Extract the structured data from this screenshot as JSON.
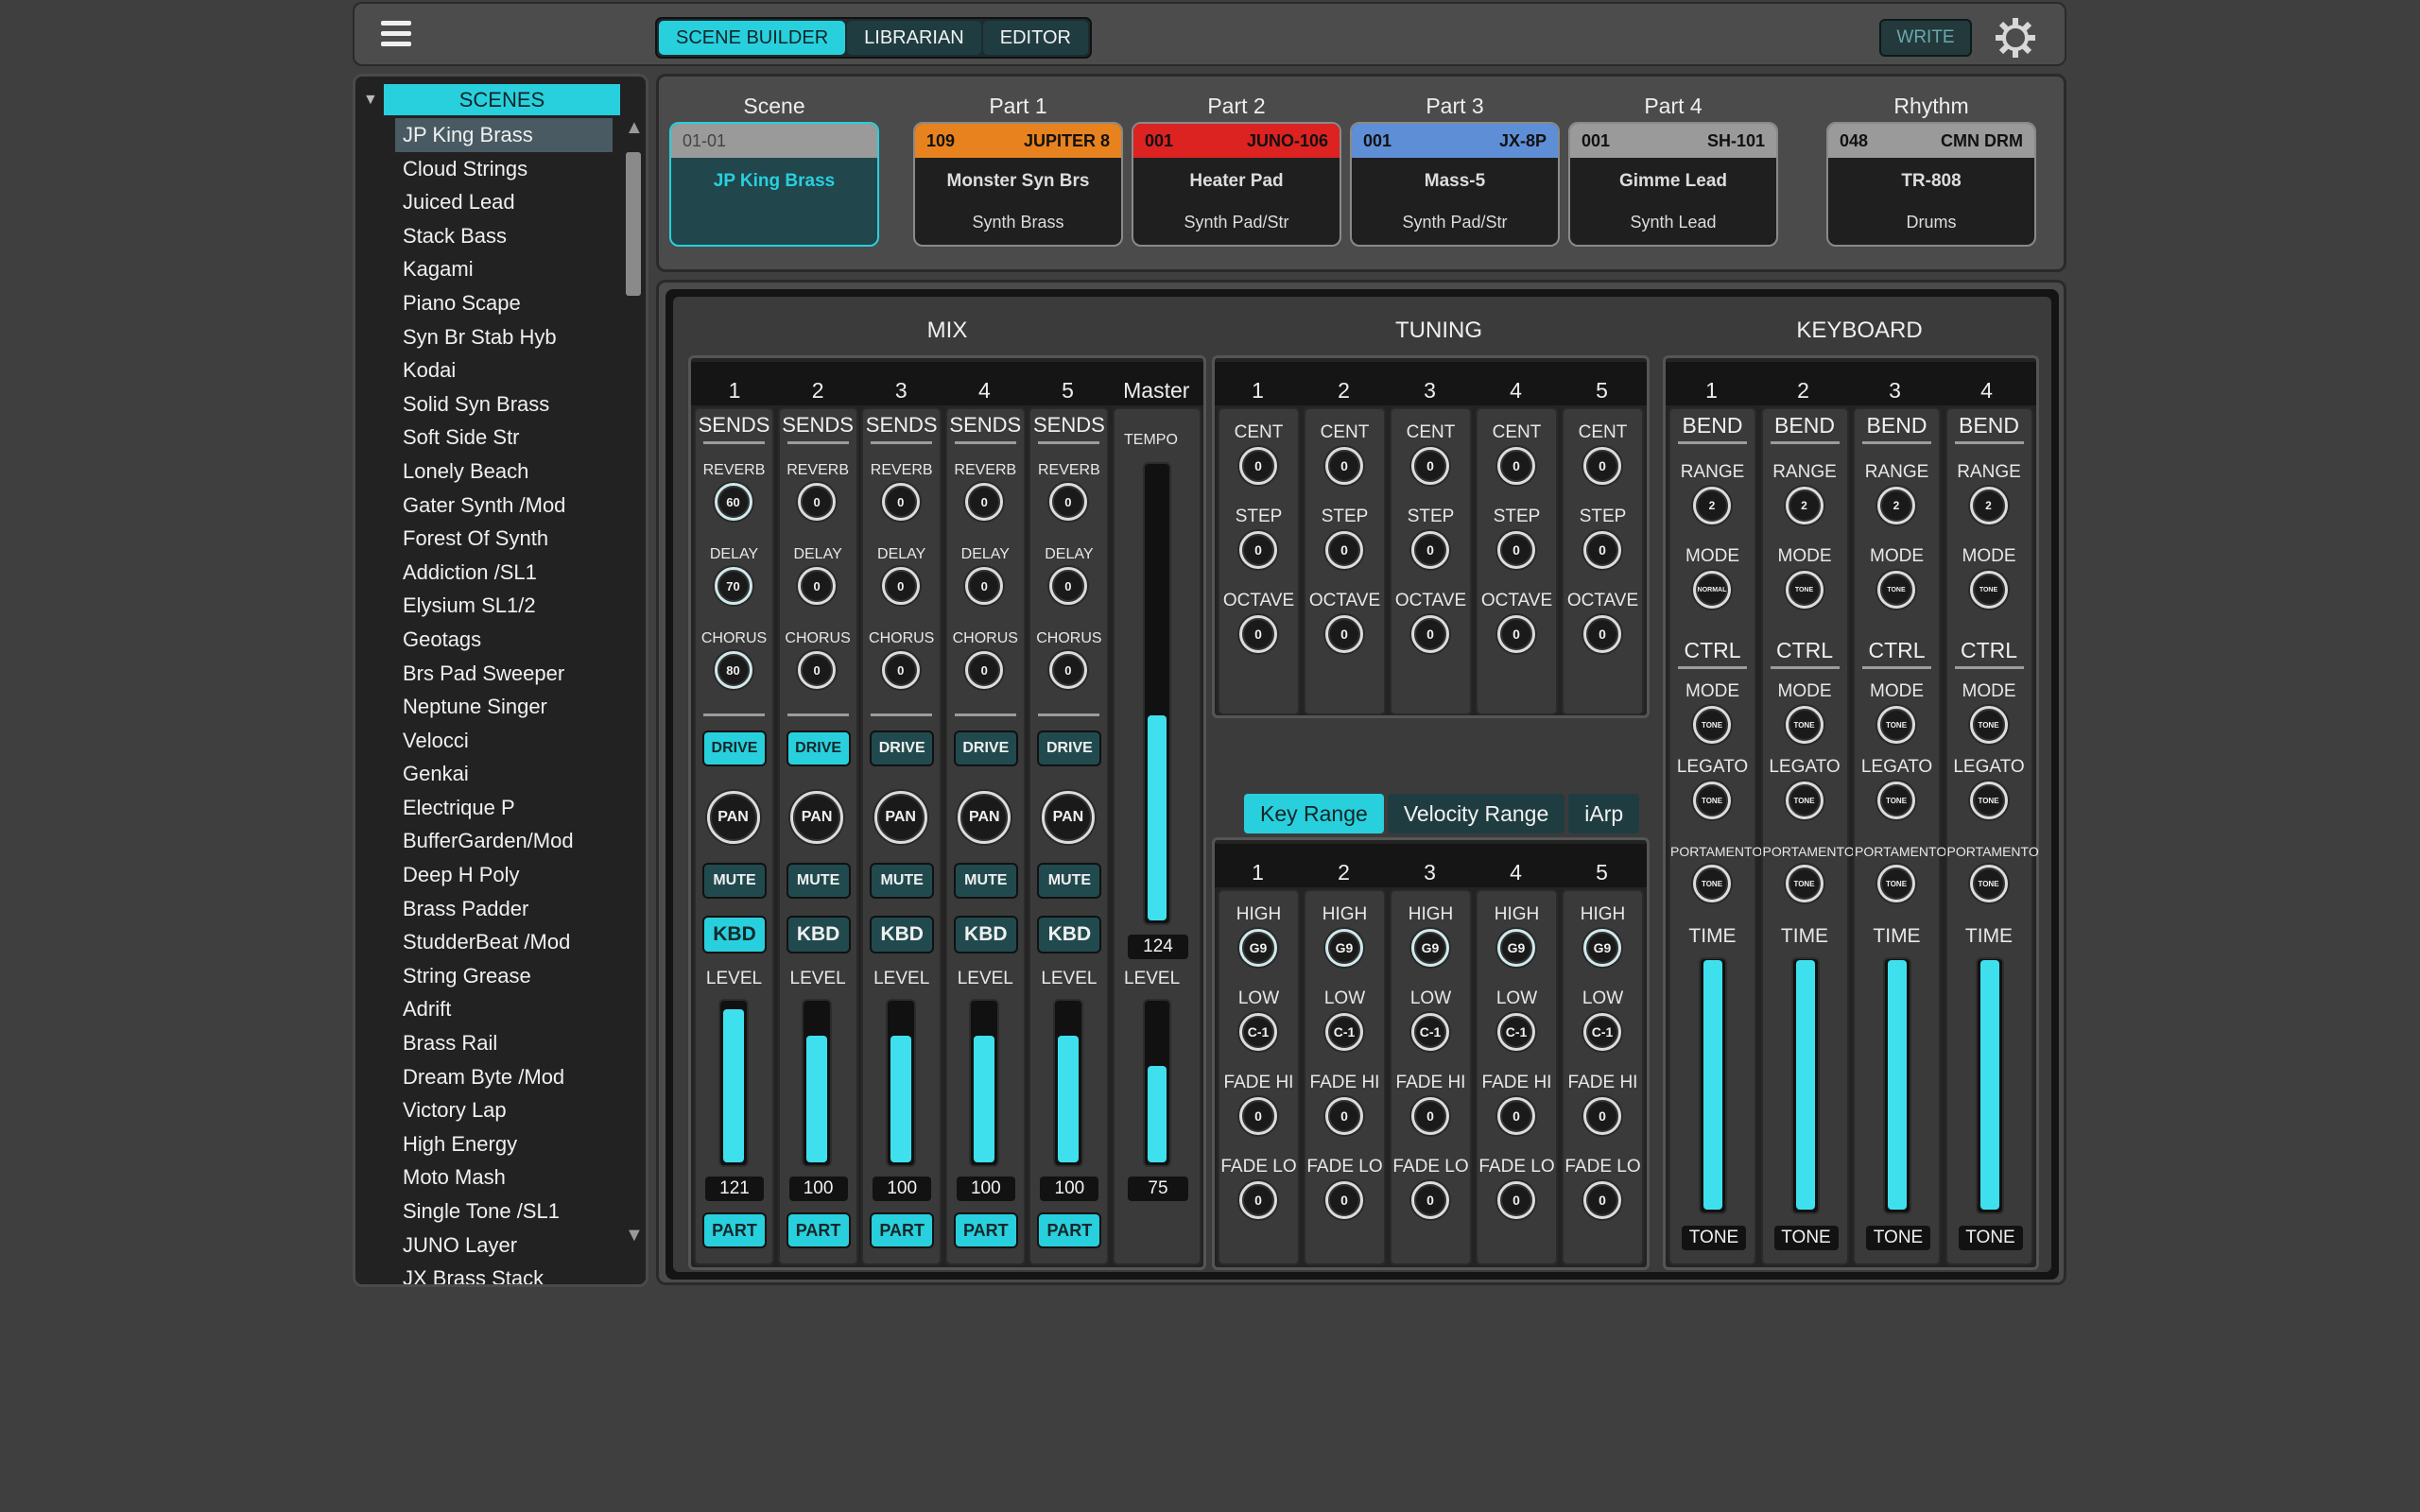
{
  "topbar": {
    "tabs": [
      {
        "label": "SCENE BUILDER",
        "active": true
      },
      {
        "label": "LIBRARIAN",
        "active": false
      },
      {
        "label": "EDITOR",
        "active": false
      }
    ],
    "write_label": "WRITE",
    "icons": {
      "menu": "hamburger-menu-icon",
      "settings": "gear-icon"
    }
  },
  "colors": {
    "accent": "#28d0dd",
    "jupiter": "#e8821e",
    "juno": "#dd2222",
    "jx": "#5e8fd6",
    "sh": "#9a9a9a",
    "drum": "#9a9a9a"
  },
  "scenes": {
    "title": "SCENES",
    "selected_index": 0,
    "items": [
      "JP King Brass",
      "Cloud Strings",
      "Juiced Lead",
      "Stack Bass",
      "Kagami",
      "Piano Scape",
      "Syn Br Stab Hyb",
      "Kodai",
      "Solid Syn Brass",
      "Soft Side Str",
      "Lonely Beach",
      "Gater Synth /Mod",
      "Forest Of Synth",
      "Addiction /SL1",
      "Elysium SL1/2",
      "Geotags",
      "Brs Pad Sweeper",
      "Neptune Singer",
      "Velocci",
      "Genkai",
      "Electrique P",
      "BufferGarden/Mod",
      "Deep H Poly",
      "Brass Padder",
      "StudderBeat /Mod",
      "String Grease",
      "Adrift",
      "Brass Rail",
      "Dream Byte /Mod",
      "Victory Lap",
      "High Energy",
      "Moto Mash",
      "Single Tone /SL1",
      "JUNO Layer",
      "JX Brass Stack"
    ]
  },
  "header": {
    "scene": {
      "label": "Scene",
      "number": "01-01",
      "name": "JP King Brass"
    },
    "parts": [
      {
        "label": "Part 1",
        "num": "109",
        "engine": "JUPITER 8",
        "name": "Monster Syn Brs",
        "category": "Synth Brass",
        "color": "#e8821e"
      },
      {
        "label": "Part 2",
        "num": "001",
        "engine": "JUNO-106",
        "name": "Heater Pad",
        "category": "Synth Pad/Str",
        "color": "#dd2222"
      },
      {
        "label": "Part 3",
        "num": "001",
        "engine": "JX-8P",
        "name": "Mass-5",
        "category": "Synth Pad/Str",
        "color": "#5e8fd6"
      },
      {
        "label": "Part 4",
        "num": "001",
        "engine": "SH-101",
        "name": "Gimme Lead",
        "category": "Synth Lead",
        "color": "#9a9a9a"
      },
      {
        "label": "Rhythm",
        "num": "048",
        "engine": "CMN DRM",
        "name": "TR-808",
        "category": "Drums",
        "color": "#9a9a9a"
      }
    ]
  },
  "mix": {
    "title": "MIX",
    "master_label": "Master",
    "tempo_label": "TEMPO",
    "tempo": "124",
    "tempo_fill": 0.45,
    "master_level": "75",
    "master_fill": 0.6,
    "labels": {
      "sends": "SENDS",
      "reverb": "REVERB",
      "delay": "DELAY",
      "chorus": "CHORUS",
      "drive": "DRIVE",
      "pan": "PAN",
      "mute": "MUTE",
      "kbd": "KBD",
      "level": "LEVEL",
      "part": "PART"
    },
    "channels": [
      {
        "num": "1",
        "reverb": "60",
        "delay": "70",
        "chorus": "80",
        "drive_on": true,
        "kbd_on": true,
        "level": "121",
        "fill": 0.95
      },
      {
        "num": "2",
        "reverb": "0",
        "delay": "0",
        "chorus": "0",
        "drive_on": true,
        "kbd_on": false,
        "level": "100",
        "fill": 0.79
      },
      {
        "num": "3",
        "reverb": "0",
        "delay": "0",
        "chorus": "0",
        "drive_on": false,
        "kbd_on": false,
        "level": "100",
        "fill": 0.79
      },
      {
        "num": "4",
        "reverb": "0",
        "delay": "0",
        "chorus": "0",
        "drive_on": false,
        "kbd_on": false,
        "level": "100",
        "fill": 0.79
      },
      {
        "num": "5",
        "reverb": "0",
        "delay": "0",
        "chorus": "0",
        "drive_on": false,
        "kbd_on": false,
        "level": "100",
        "fill": 0.79
      }
    ]
  },
  "tuning": {
    "title": "TUNING",
    "labels": {
      "cent": "CENT",
      "step": "STEP",
      "octave": "OCTAVE"
    },
    "channels": [
      {
        "num": "1",
        "cent": "0",
        "step": "0",
        "octave": "0"
      },
      {
        "num": "2",
        "cent": "0",
        "step": "0",
        "octave": "0"
      },
      {
        "num": "3",
        "cent": "0",
        "step": "0",
        "octave": "0"
      },
      {
        "num": "4",
        "cent": "0",
        "step": "0",
        "octave": "0"
      },
      {
        "num": "5",
        "cent": "0",
        "step": "0",
        "octave": "0"
      }
    ]
  },
  "range": {
    "tabs": [
      {
        "label": "Key Range",
        "active": true
      },
      {
        "label": "Velocity Range",
        "active": false
      },
      {
        "label": "iArp",
        "active": false
      }
    ],
    "labels": {
      "high": "HIGH",
      "low": "LOW",
      "fade_hi": "FADE HI",
      "fade_lo": "FADE LO"
    },
    "channels": [
      {
        "num": "1",
        "high": "G9",
        "low": "C-1",
        "fade_hi": "0",
        "fade_lo": "0"
      },
      {
        "num": "2",
        "high": "G9",
        "low": "C-1",
        "fade_hi": "0",
        "fade_lo": "0"
      },
      {
        "num": "3",
        "high": "G9",
        "low": "C-1",
        "fade_hi": "0",
        "fade_lo": "0"
      },
      {
        "num": "4",
        "high": "G9",
        "low": "C-1",
        "fade_hi": "0",
        "fade_lo": "0"
      },
      {
        "num": "5",
        "high": "G9",
        "low": "C-1",
        "fade_hi": "0",
        "fade_lo": "0"
      }
    ]
  },
  "keyboard": {
    "title": "KEYBOARD",
    "labels": {
      "bend": "BEND",
      "range": "RANGE",
      "mode": "MODE",
      "ctrl": "CTRL",
      "legato": "LEGATO",
      "portamento": "PORTAMENTO",
      "time": "TIME"
    },
    "channels": [
      {
        "num": "1",
        "range": "2",
        "bend_mode": "NORMAL",
        "ctrl_mode": "TONE",
        "legato": "TONE",
        "portamento": "TONE",
        "time": "TONE",
        "fill": 1.0
      },
      {
        "num": "2",
        "range": "2",
        "bend_mode": "TONE",
        "ctrl_mode": "TONE",
        "legato": "TONE",
        "portamento": "TONE",
        "time": "TONE",
        "fill": 1.0
      },
      {
        "num": "3",
        "range": "2",
        "bend_mode": "TONE",
        "ctrl_mode": "TONE",
        "legato": "TONE",
        "portamento": "TONE",
        "time": "TONE",
        "fill": 1.0
      },
      {
        "num": "4",
        "range": "2",
        "bend_mode": "TONE",
        "ctrl_mode": "TONE",
        "legato": "TONE",
        "portamento": "TONE",
        "time": "TONE",
        "fill": 1.0
      }
    ]
  }
}
